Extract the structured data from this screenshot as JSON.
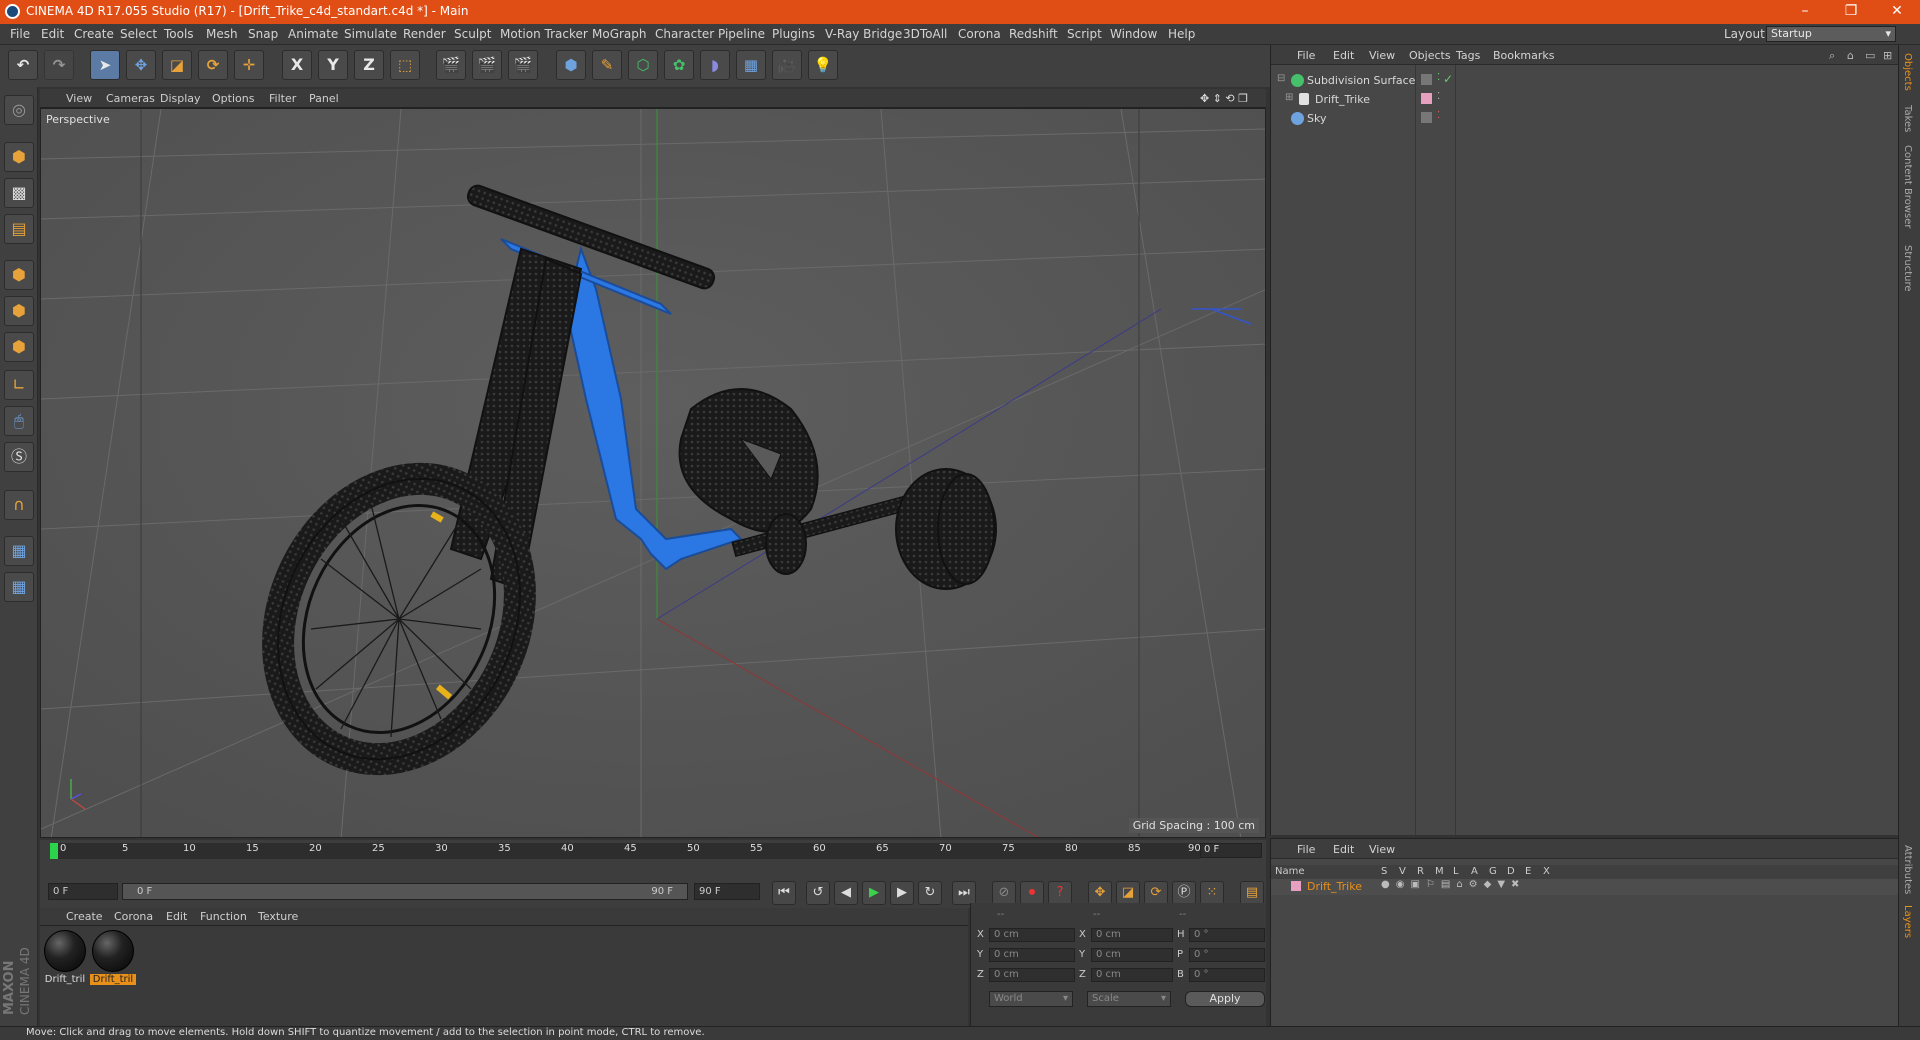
{
  "window": {
    "title": "CINEMA 4D R17.055 Studio (R17) - [Drift_Trike_c4d_standart.c4d *] - Main",
    "controls": [
      "–",
      "❐",
      "✕"
    ]
  },
  "menubar": {
    "items": [
      "File",
      "Edit",
      "Create",
      "Select",
      "Tools",
      "Mesh",
      "Snap",
      "Animate",
      "Simulate",
      "Render",
      "Sculpt",
      "Motion Tracker",
      "MoGraph",
      "Character",
      "Pipeline",
      "Plugins",
      "V-Ray Bridge",
      "3DToAll",
      "Corona",
      "Redshift",
      "Script",
      "Window",
      "Help"
    ],
    "layout_label": "Layout:",
    "layout_value": "Startup"
  },
  "toolbar": {
    "axis_x": "X",
    "axis_y": "Y",
    "axis_z": "Z"
  },
  "viewport": {
    "menu": [
      "View",
      "Cameras",
      "Display",
      "Options",
      "Filter",
      "Panel"
    ],
    "label": "Perspective",
    "grid_spacing": "Grid Spacing : 100 cm"
  },
  "timeline": {
    "ticks": [
      "0",
      "5",
      "10",
      "15",
      "20",
      "25",
      "30",
      "35",
      "40",
      "45",
      "50",
      "55",
      "60",
      "65",
      "70",
      "75",
      "80",
      "85",
      "90"
    ],
    "current_frame": "0 F",
    "start_field": "0 F",
    "slider_start": "0 F",
    "slider_end": "90 F",
    "end_field": "90 F"
  },
  "material_manager": {
    "menu": [
      "Create",
      "Corona",
      "Edit",
      "Function",
      "Texture"
    ],
    "materials": [
      {
        "label": "Drift_tril"
      },
      {
        "label": "Drift_tril"
      }
    ],
    "brand_top": "MAXON",
    "brand_bottom": "CINEMA 4D"
  },
  "coordinates": {
    "header": [
      "--",
      "--",
      "--"
    ],
    "rows": [
      {
        "a": "X",
        "av": "0 cm",
        "b": "X",
        "bv": "0 cm",
        "c": "H",
        "cv": "0 °"
      },
      {
        "a": "Y",
        "av": "0 cm",
        "b": "Y",
        "bv": "0 cm",
        "c": "P",
        "cv": "0 °"
      },
      {
        "a": "Z",
        "av": "0 cm",
        "b": "Z",
        "bv": "0 cm",
        "c": "B",
        "cv": "0 °"
      }
    ],
    "mode": "World",
    "scale": "Scale",
    "apply": "Apply"
  },
  "object_manager": {
    "menu": [
      "File",
      "Edit",
      "View",
      "Objects",
      "Tags",
      "Bookmarks"
    ],
    "objects": [
      {
        "name": "Subdivision Surface"
      },
      {
        "name": "Drift_Trike"
      },
      {
        "name": "Sky"
      }
    ]
  },
  "layer_manager": {
    "menu": [
      "File",
      "Edit",
      "View"
    ],
    "columns": [
      "Name",
      "S",
      "V",
      "R",
      "M",
      "L",
      "A",
      "G",
      "D",
      "E",
      "X"
    ],
    "layer_name": "Drift_Trike"
  },
  "side_tabs": [
    "Objects",
    "Takes",
    "Content Browser",
    "Structure",
    "Attributes",
    "Layers"
  ],
  "status": {
    "text": "Move: Click and drag to move elements. Hold down SHIFT to quantize movement / add to the selection in point mode, CTRL to remove."
  },
  "colors": {
    "titlebar": "#e04e16",
    "frame": "#2b78e4",
    "accent": "#e8901a"
  }
}
